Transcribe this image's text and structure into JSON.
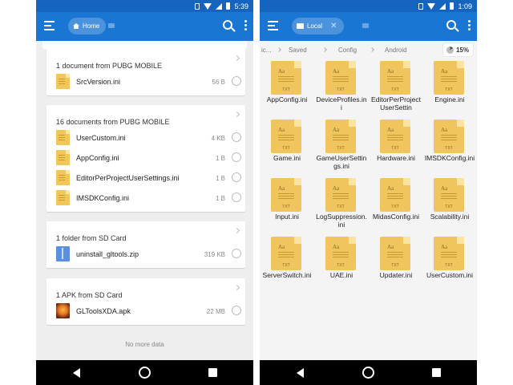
{
  "left_screen": {
    "status": {
      "time": "5:39"
    },
    "appbar": {
      "chip_label": "Home"
    },
    "cards": [
      {
        "title": "1 document from PUBG MOBILE",
        "rows": [
          {
            "name": "SrcVersion.ini",
            "size": "56 B",
            "icon": "ini-file-icon"
          }
        ]
      },
      {
        "title": "16 documents from PUBG MOBILE",
        "rows": [
          {
            "name": "UserCustom.ini",
            "size": "4 KB",
            "icon": "ini-file-icon"
          },
          {
            "name": "AppConfig.ini",
            "size": "1 B",
            "icon": "ini-file-icon"
          },
          {
            "name": "EditorPerProjectUserSettings.ini",
            "size": "1 B",
            "icon": "ini-file-icon"
          },
          {
            "name": "IMSDKConfig.ini",
            "size": "1 B",
            "icon": "ini-file-icon"
          }
        ]
      },
      {
        "title": "1 folder from SD Card",
        "rows": [
          {
            "name": "uninstall_gltools.zip",
            "size": "319 KB",
            "icon": "zip-file-icon"
          }
        ]
      },
      {
        "title": "1 APK from SD Card",
        "rows": [
          {
            "name": "GLToolsXDA.apk",
            "size": "22 MB",
            "icon": "apk-icon"
          }
        ]
      }
    ],
    "footer": "No more data"
  },
  "right_screen": {
    "status": {
      "time": "1:09"
    },
    "appbar": {
      "chip_label": "Local"
    },
    "breadcrumb": [
      "ic...",
      "Saved",
      "Config",
      "Android"
    ],
    "storage": "15%",
    "files": [
      "AppConfig.ini",
      "DeviceProfiles.ini",
      "EditorPerProjectUserSettin",
      "Engine.ini",
      "Game.ini",
      "GameUserSettings.ini",
      "Hardware.ini",
      "IMSDKConfig.ini",
      "Input.ini",
      "LogSuppression.ini",
      "MidasConfig.ini",
      "Scalability.ini",
      "ServerSwitch.ini",
      "UAE.ini",
      "Updater.ini",
      "UserCustom.ini"
    ],
    "file_icon_glyph": "Aa",
    "file_icon_ext": "TXT"
  },
  "colors": {
    "appbar": "#1976d2",
    "statusbar": "#1565c0",
    "file_icon": "#f0c55e"
  }
}
